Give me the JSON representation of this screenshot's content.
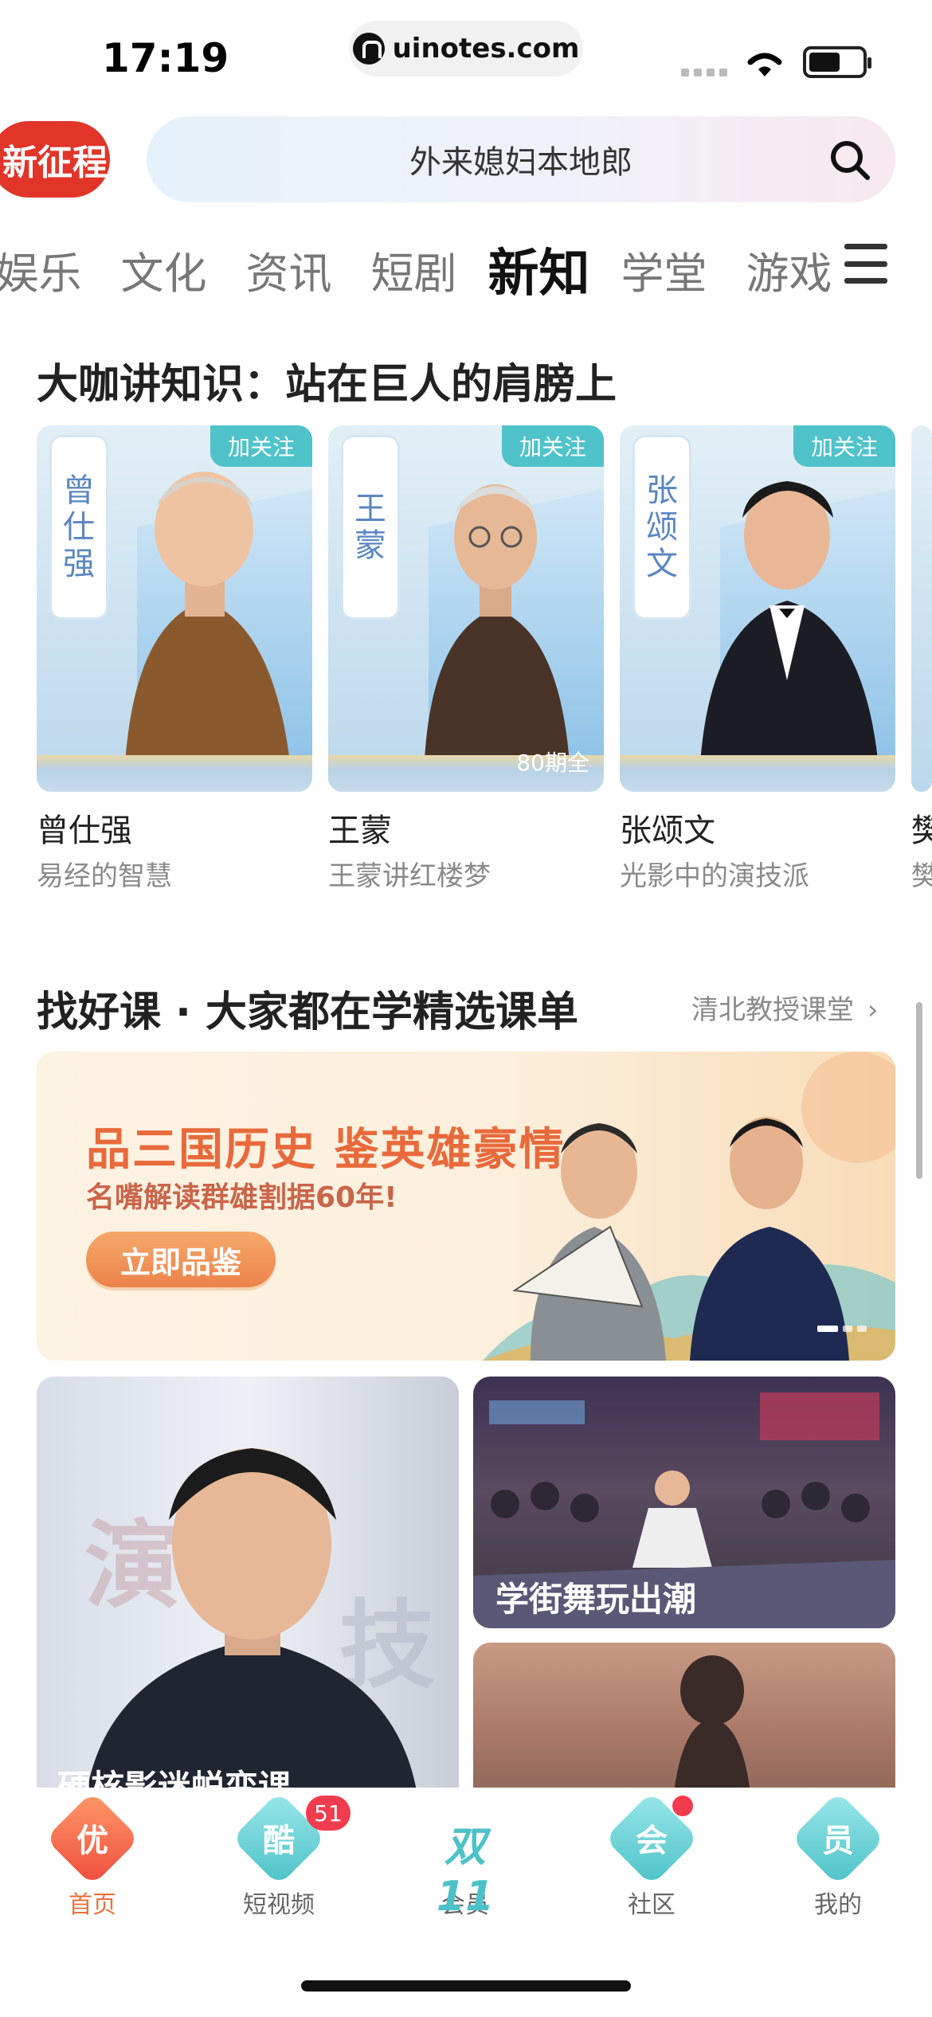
{
  "status_bar": {
    "time": "17:19",
    "url": "uinotes.com"
  },
  "header": {
    "promo_tag": "新征程",
    "search_query": "外来媳妇本地郎"
  },
  "tabs": [
    {
      "label": "娱乐"
    },
    {
      "label": "文化"
    },
    {
      "label": "资讯"
    },
    {
      "label": "短剧"
    },
    {
      "label": "新知",
      "active": true
    },
    {
      "label": "学堂"
    },
    {
      "label": "游戏"
    }
  ],
  "section1": {
    "title": "大咖讲知识：站在巨人的肩膀上",
    "follow_label": "加关注",
    "cards": [
      {
        "name": "曾仕强",
        "vertical": [
          "曾",
          "仕",
          "强"
        ],
        "subtitle": "易经的智慧",
        "episodes": ""
      },
      {
        "name": "王蒙",
        "vertical": [
          "王",
          "蒙"
        ],
        "subtitle": "王蒙讲红楼梦",
        "episodes": "80期全"
      },
      {
        "name": "张颂文",
        "vertical": [
          "张",
          "颂",
          "文"
        ],
        "subtitle": "光影中的演技派",
        "episodes": ""
      },
      {
        "name": "樊",
        "subtitle": "樊"
      }
    ]
  },
  "section2": {
    "title": "找好课 · 大家都在学精选课单",
    "more_link": "清北教授课堂",
    "banner": {
      "headline": "品三国历史 鉴英雄豪情",
      "subheadline": "名嘴解读群雄割据60年!",
      "cta": "立即品鉴"
    },
    "tiles": [
      {
        "label": "硬核影迷蜕变课",
        "overlay": [
          "演",
          "技"
        ]
      },
      {
        "label": "学街舞玩出潮"
      },
      {
        "label": ""
      }
    ]
  },
  "bottom_nav": [
    {
      "label": "首页",
      "glyph": "优",
      "active": true
    },
    {
      "label": "短视频",
      "glyph": "酷",
      "badge": "51"
    },
    {
      "label": "会员",
      "glyph": "双11"
    },
    {
      "label": "社区",
      "glyph": "会",
      "dot": true
    },
    {
      "label": "我的",
      "glyph": "员"
    }
  ],
  "colors": {
    "accent": "#e9733d",
    "follow": "#4fc3c9",
    "badge": "#f13c4f",
    "promo": "#e2352a"
  }
}
